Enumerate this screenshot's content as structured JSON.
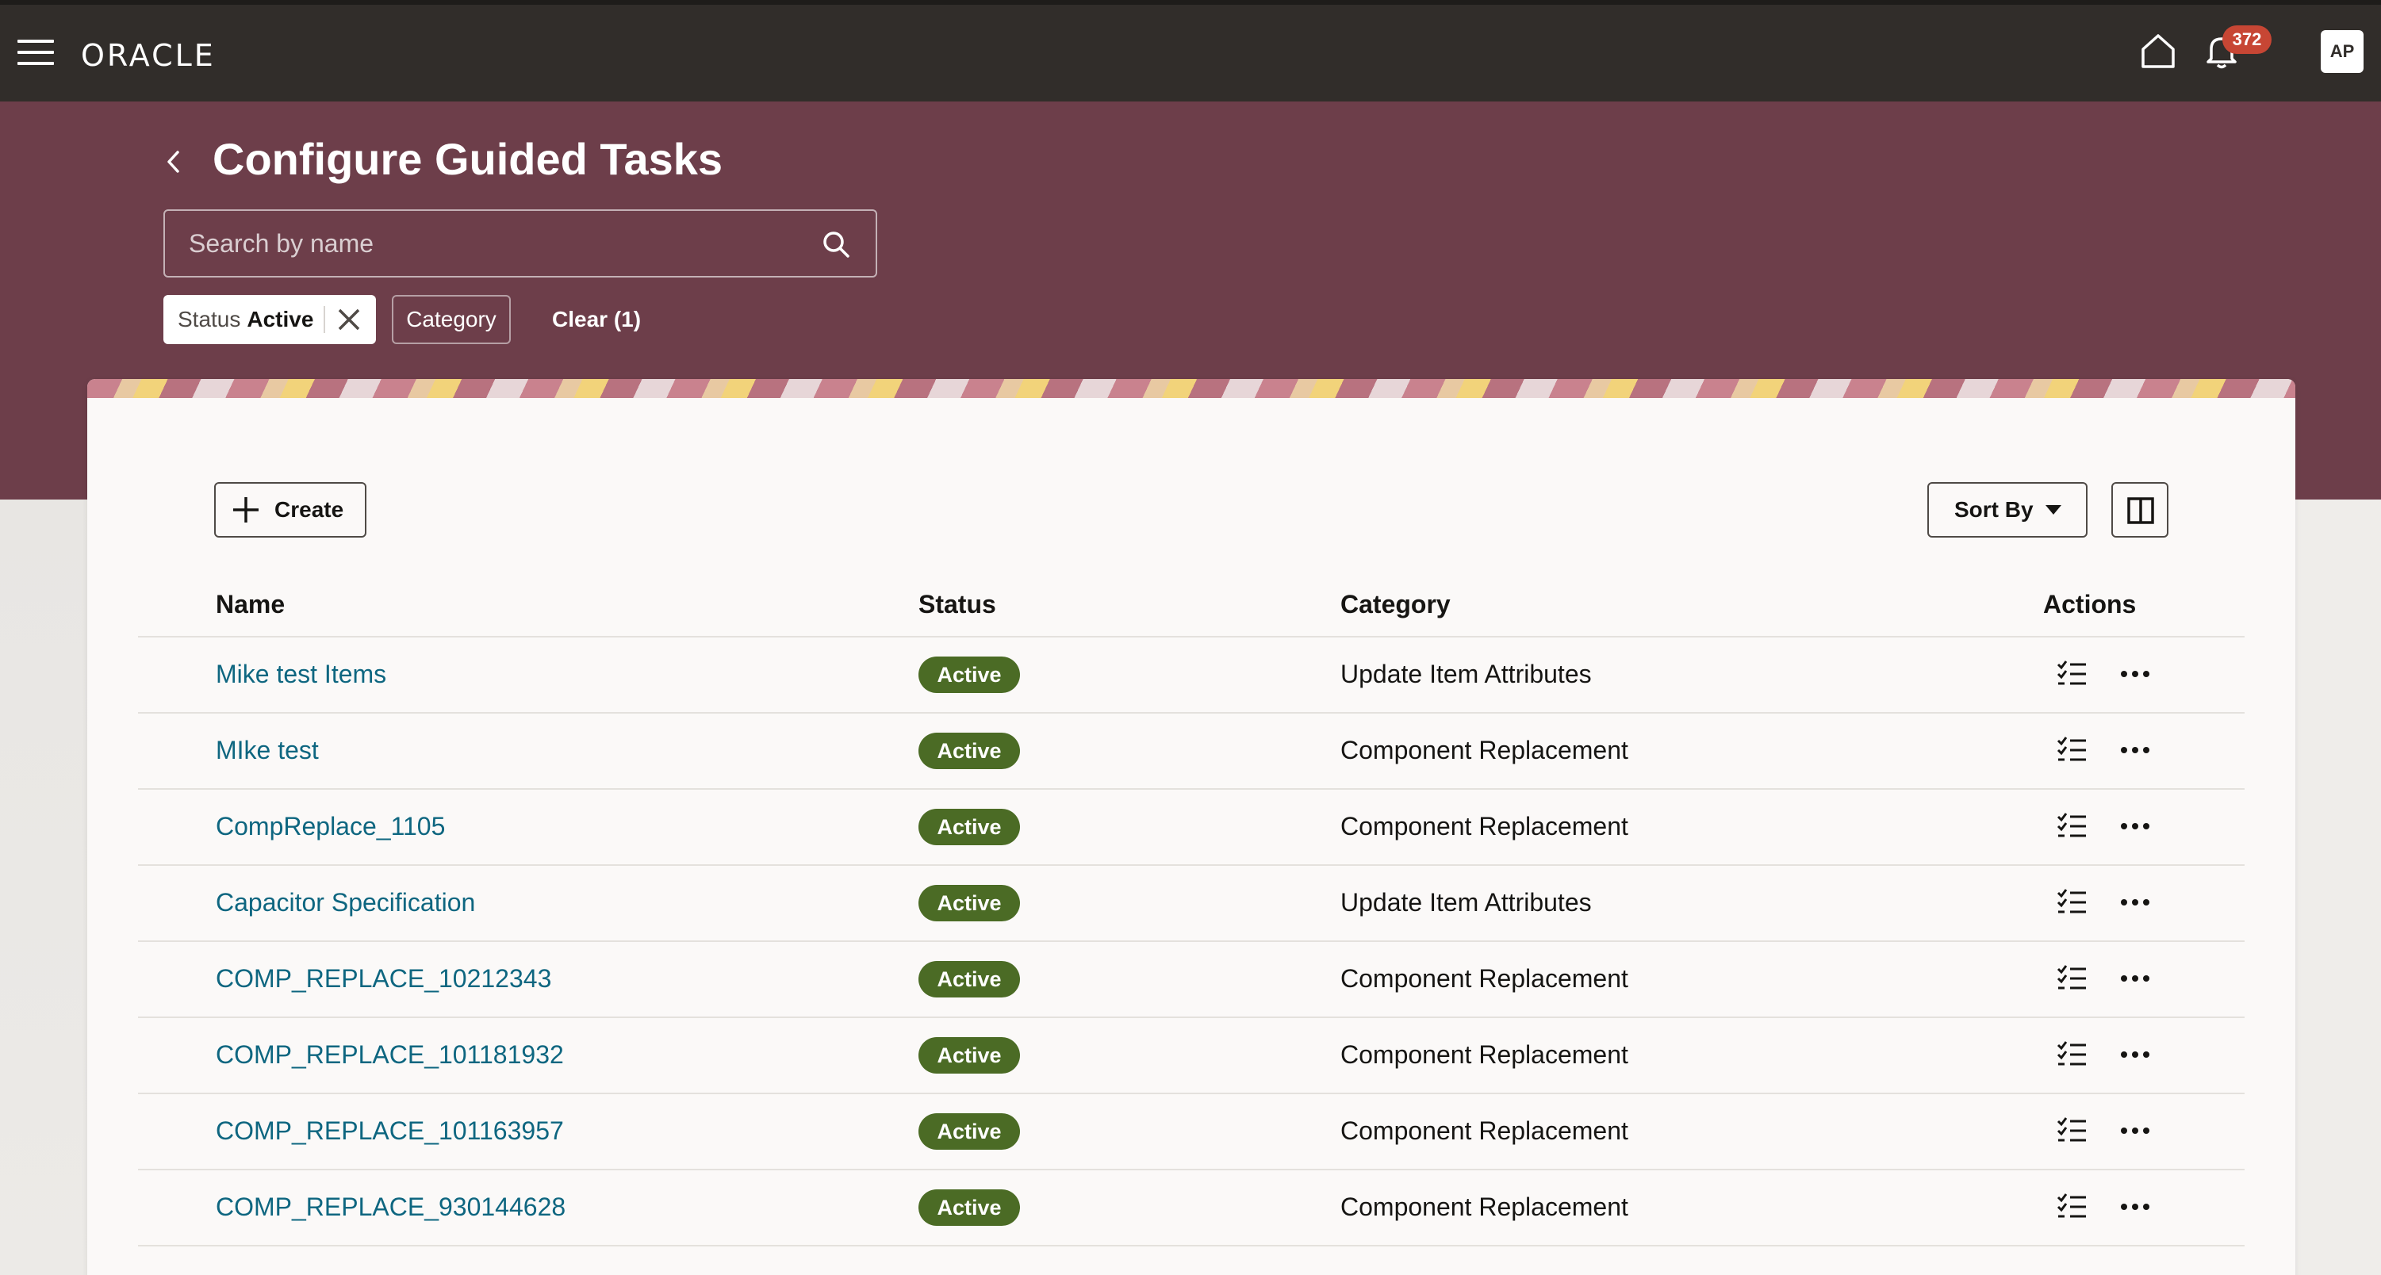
{
  "topbar": {
    "logo": "ORACLE",
    "notification_count": "372",
    "user_initials": "AP"
  },
  "header": {
    "title": "Configure Guided Tasks",
    "search_placeholder": "Search by name",
    "filters": {
      "status_label": "Status",
      "status_value": "Active",
      "category_label": "Category",
      "clear_label": "Clear (1)"
    }
  },
  "toolbar": {
    "create_label": "Create",
    "sort_label": "Sort By"
  },
  "table": {
    "columns": [
      "Name",
      "Status",
      "Category",
      "Actions"
    ],
    "rows": [
      {
        "name": "Mike test Items",
        "status": "Active",
        "category": "Update Item Attributes"
      },
      {
        "name": "MIke test",
        "status": "Active",
        "category": "Component Replacement"
      },
      {
        "name": "CompReplace_1105",
        "status": "Active",
        "category": "Component Replacement"
      },
      {
        "name": "Capacitor Specification",
        "status": "Active",
        "category": "Update Item Attributes"
      },
      {
        "name": "COMP_REPLACE_10212343",
        "status": "Active",
        "category": "Component Replacement"
      },
      {
        "name": "COMP_REPLACE_101181932",
        "status": "Active",
        "category": "Component Replacement"
      },
      {
        "name": "COMP_REPLACE_101163957",
        "status": "Active",
        "category": "Component Replacement"
      },
      {
        "name": "COMP_REPLACE_930144628",
        "status": "Active",
        "category": "Component Replacement"
      }
    ]
  },
  "colors": {
    "topbar": "#312d2a",
    "header_band": "#6d3e4a",
    "link": "#0e6680",
    "status_active": "#4b6b25",
    "badge": "#c74634"
  }
}
